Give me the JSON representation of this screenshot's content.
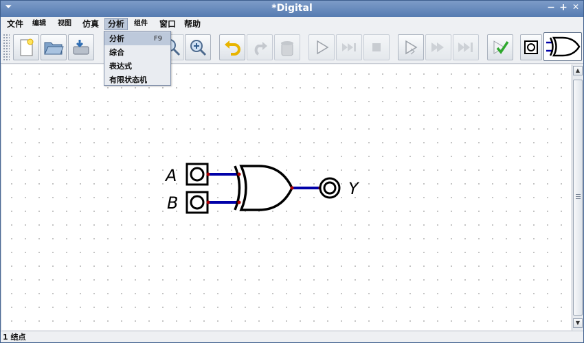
{
  "window": {
    "title": "*Digital",
    "sysmenu_icon": "chevron-down-icon",
    "minimize": "−",
    "maximize": "+",
    "close": "✕"
  },
  "menubar": {
    "items": [
      {
        "label": "文件"
      },
      {
        "label": "编辑"
      },
      {
        "label": "视图"
      },
      {
        "label": "仿真"
      },
      {
        "label": "分析"
      },
      {
        "label": "组件"
      },
      {
        "label": "窗口"
      },
      {
        "label": "帮助"
      }
    ],
    "active": "分析"
  },
  "dropdown": {
    "items": [
      {
        "label": "分析",
        "accelerator": "F9",
        "selected": true
      },
      {
        "label": "综合"
      },
      {
        "label": "表达式"
      },
      {
        "label": "有限状态机"
      }
    ]
  },
  "toolbar": {
    "buttons": [
      "new-file-icon",
      "open-folder-icon",
      "save-icon",
      "zoom-out-icon",
      "zoom-in-icon",
      "undo-icon",
      "redo-icon",
      "delete-icon",
      "play-icon",
      "step-forward-icon",
      "stop-icon",
      "step-gate-icon",
      "run-to-break-icon",
      "run-to-end-icon",
      "test-check-icon",
      "input-element-icon",
      "xor-gate-icon"
    ]
  },
  "circuit": {
    "inputs": [
      {
        "label": "A"
      },
      {
        "label": "B"
      }
    ],
    "gate": "XOR",
    "output": {
      "label": "Y"
    },
    "wire_color": "#0000a8",
    "junction_color": "#b00000"
  },
  "status": {
    "text": "1 结点"
  },
  "colors": {
    "titlebar": "#6b8dbf",
    "menu_active": "#bcc8da",
    "accent_green": "#2ea82e",
    "undo_yellow": "#e8b400"
  }
}
